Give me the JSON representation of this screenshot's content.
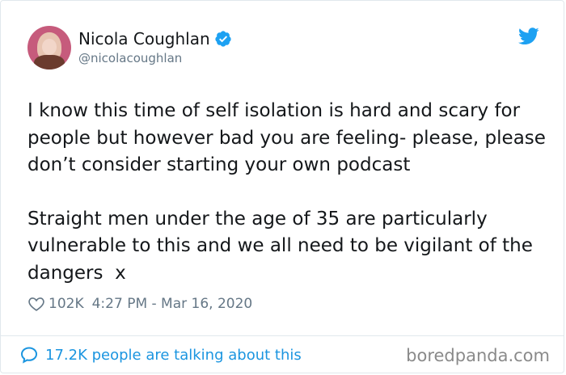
{
  "author": {
    "display_name": "Nicola Coughlan",
    "handle": "@nicolacoughlan",
    "verified": true
  },
  "tweet": {
    "paragraphs": [
      "I know this time of self isolation is hard and scary for people but however bad you are feeling- please, please don’t consider starting your own podcast",
      "Straight men under the age of 35 are particularly vulnerable to this and we all need to be vigilant of the dangers  x"
    ],
    "like_count": "102K",
    "timestamp": "4:27 PM - Mar 16, 2020"
  },
  "footer": {
    "conversation_text": "17.2K people are talking about this"
  },
  "watermark": "boredpanda.com",
  "colors": {
    "brand_blue": "#1da1f2",
    "link_blue": "#1b95e0",
    "muted_gray": "#657786"
  },
  "icons": [
    "verified-badge-icon",
    "twitter-bird-icon",
    "heart-icon",
    "speech-bubble-icon"
  ]
}
